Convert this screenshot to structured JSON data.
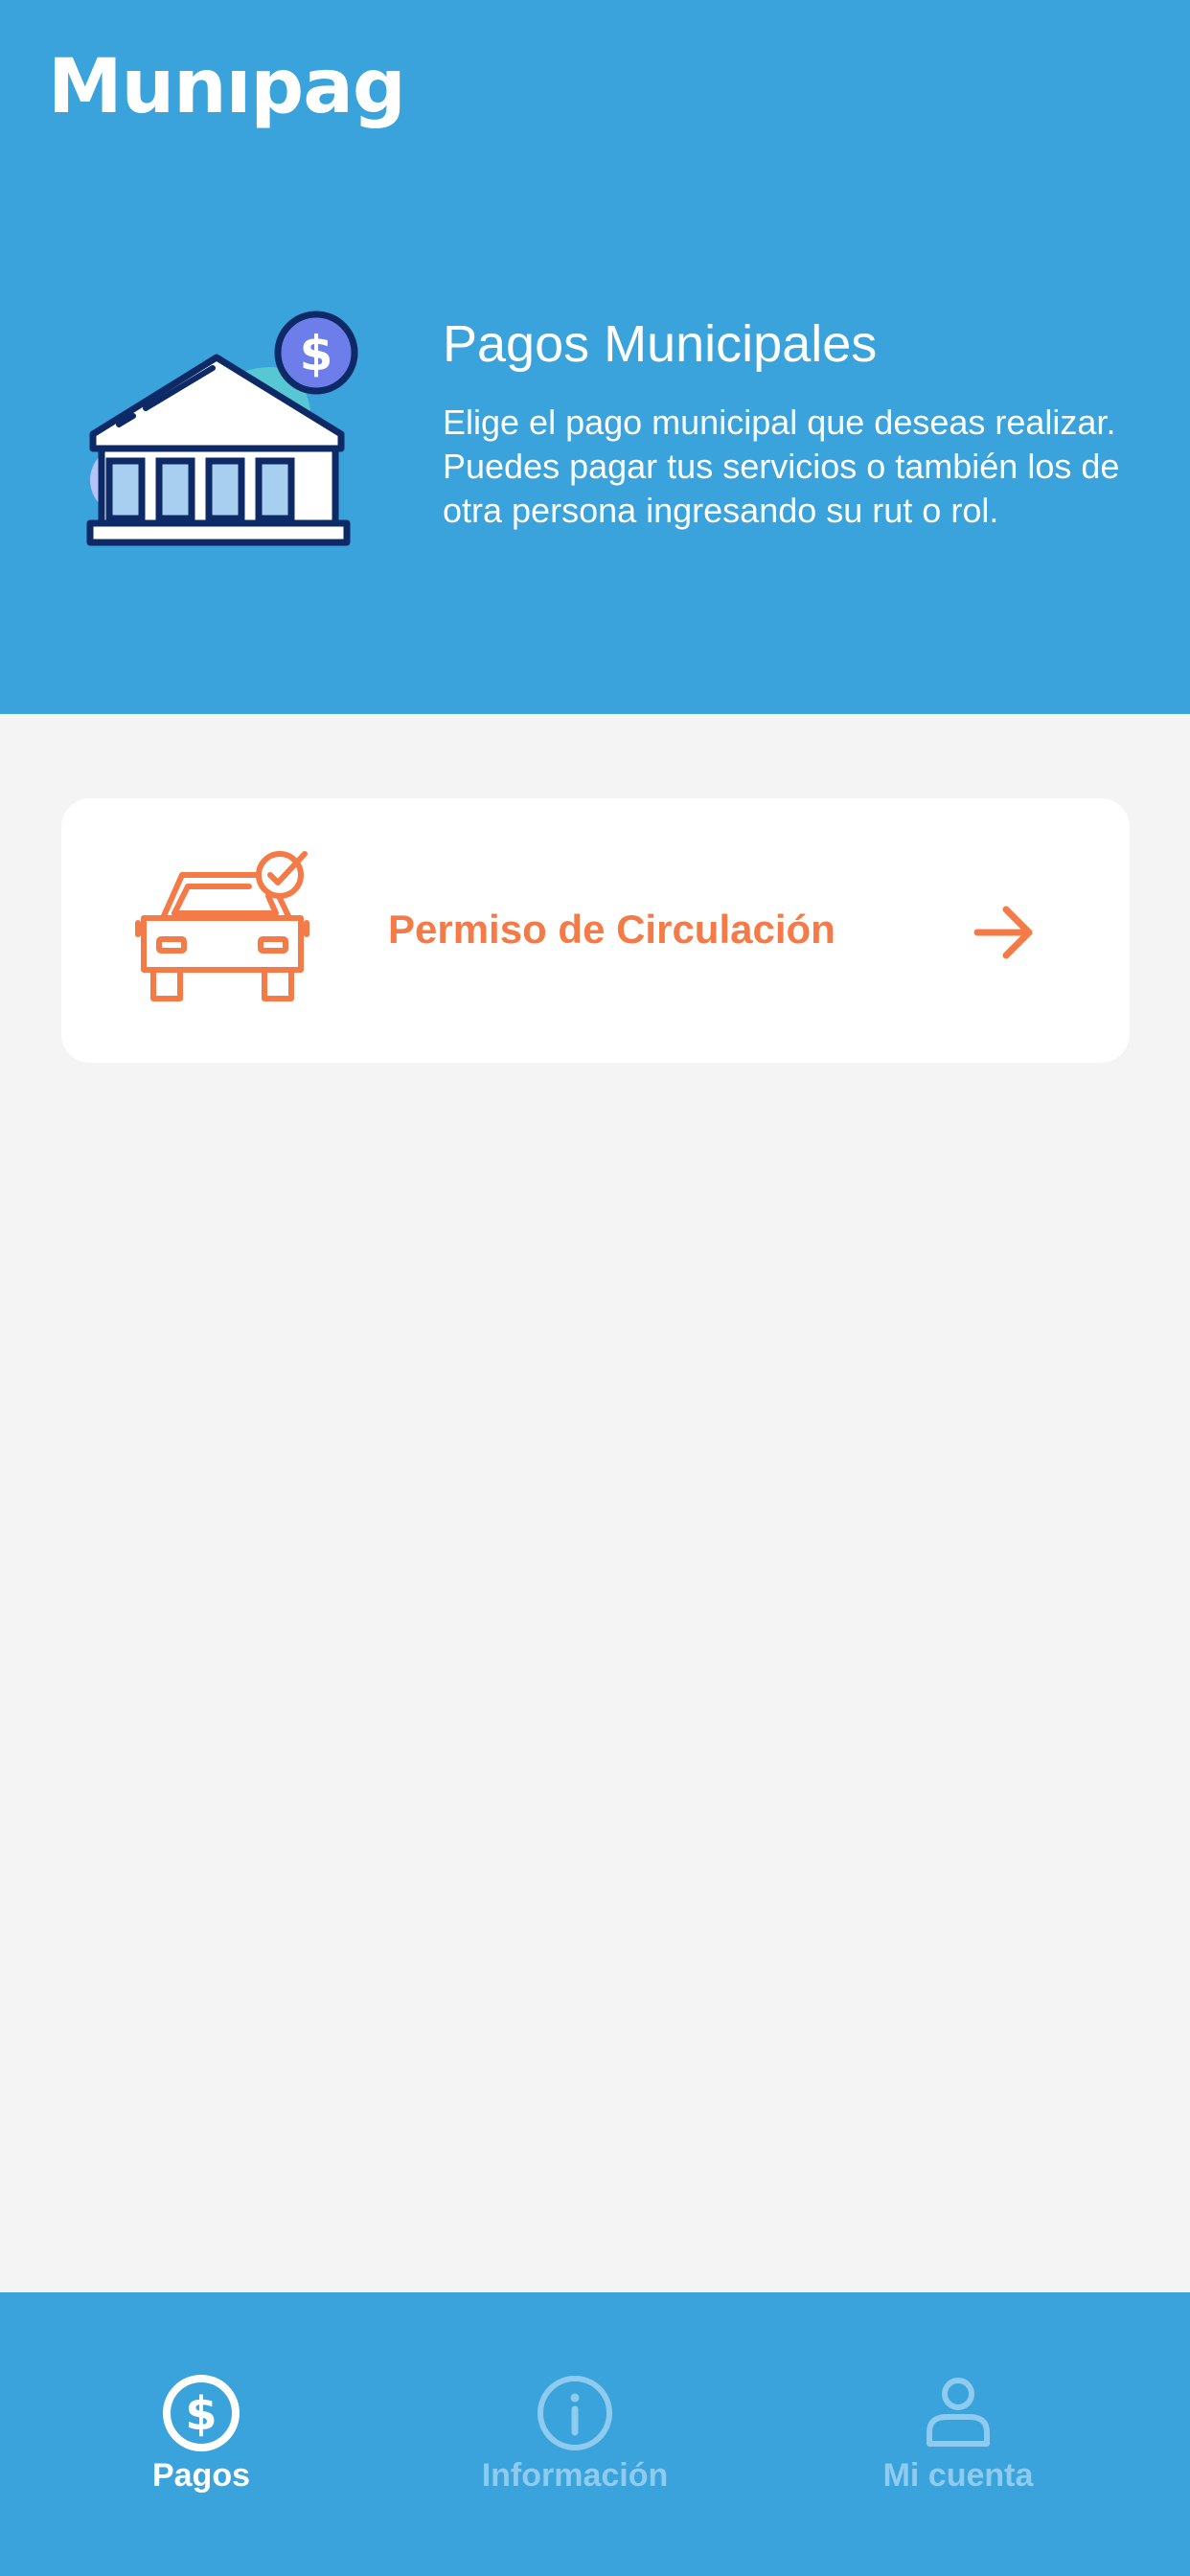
{
  "app": {
    "title": "Munıpag"
  },
  "hero": {
    "title": "Pagos Municipales",
    "description": "Elige el pago municipal que deseas realizar. Puedes pagar tus servicios o también los de otra persona ingresando su rut o rol.",
    "icon": "bank-dollar-icon"
  },
  "payments": [
    {
      "label": "Permiso de Circulación",
      "icon": "car-check-icon",
      "action_icon": "arrow-right-icon"
    }
  ],
  "nav": {
    "items": [
      {
        "label": "Pagos",
        "icon": "dollar-circle-icon",
        "active": true
      },
      {
        "label": "Información",
        "icon": "info-circle-icon",
        "active": false
      },
      {
        "label": "Mi cuenta",
        "icon": "user-icon",
        "active": false
      }
    ]
  },
  "colors": {
    "primary": "#3AA3DB",
    "accent": "#F47B47",
    "background": "#F4F4F4",
    "card": "#FFFFFF",
    "nav_inactive": "#8FCBEE"
  }
}
